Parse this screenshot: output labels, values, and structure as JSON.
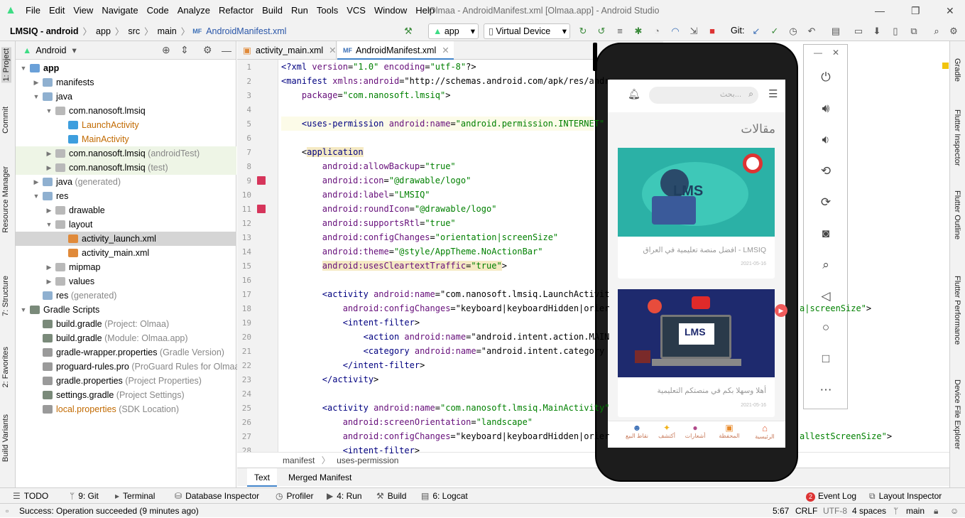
{
  "window": {
    "title": "Olmaa - AndroidManifest.xml [Olmaa.app] - Android Studio"
  },
  "menu": [
    "File",
    "Edit",
    "View",
    "Navigate",
    "Code",
    "Analyze",
    "Refactor",
    "Build",
    "Run",
    "Tools",
    "VCS",
    "Window",
    "Help"
  ],
  "breadcrumb": [
    "LMSIQ - android",
    "app",
    "src",
    "main",
    "AndroidManifest.xml"
  ],
  "toolbar": {
    "run_config": "app",
    "device": "Virtual Device",
    "git_label": "Git:"
  },
  "project_panel": {
    "view": "Android"
  },
  "tree": [
    {
      "t": "app",
      "d": 0,
      "arrow": "▼",
      "bold": true,
      "ic": "#6aa0d8"
    },
    {
      "t": "manifests",
      "d": 1,
      "arrow": "▶",
      "ic": "#8fb0d0"
    },
    {
      "t": "java",
      "d": 1,
      "arrow": "▼",
      "ic": "#8fb0d0"
    },
    {
      "t": "com.nanosoft.lmsiq",
      "d": 2,
      "arrow": "▼",
      "ic": "#b9b9b9"
    },
    {
      "t": "LaunchActivity",
      "d": 3,
      "arrow": "",
      "ic": "#3d9ede",
      "cls": "orange"
    },
    {
      "t": "MainActivity",
      "d": 3,
      "arrow": "",
      "ic": "#3d9ede",
      "cls": "orange"
    },
    {
      "t": "com.nanosoft.lmsiq",
      "d": 2,
      "arrow": "▶",
      "ic": "#b9b9b9",
      "suffix": " (androidTest)",
      "bg": "#eef5e6"
    },
    {
      "t": "com.nanosoft.lmsiq",
      "d": 2,
      "arrow": "▶",
      "ic": "#b9b9b9",
      "suffix": " (test)",
      "bg": "#eef5e6"
    },
    {
      "t": "java",
      "d": 1,
      "arrow": "▶",
      "ic": "#8fb0d0",
      "suffix": " (generated)"
    },
    {
      "t": "res",
      "d": 1,
      "arrow": "▼",
      "ic": "#8fb0d0"
    },
    {
      "t": "drawable",
      "d": 2,
      "arrow": "▶",
      "ic": "#b9b9b9"
    },
    {
      "t": "layout",
      "d": 2,
      "arrow": "▼",
      "ic": "#b9b9b9"
    },
    {
      "t": "activity_launch.xml",
      "d": 3,
      "arrow": "",
      "ic": "#e08a3a",
      "bg": "#d5d5d5"
    },
    {
      "t": "activity_main.xml",
      "d": 3,
      "arrow": "",
      "ic": "#e08a3a"
    },
    {
      "t": "mipmap",
      "d": 2,
      "arrow": "▶",
      "ic": "#b9b9b9"
    },
    {
      "t": "values",
      "d": 2,
      "arrow": "▶",
      "ic": "#b9b9b9"
    },
    {
      "t": "res",
      "d": 1,
      "arrow": "",
      "ic": "#8fb0d0",
      "suffix": " (generated)"
    },
    {
      "t": "Gradle Scripts",
      "d": 0,
      "arrow": "▼",
      "ic": "#7a8a7a"
    },
    {
      "t": "build.gradle",
      "d": 1,
      "arrow": "",
      "ic": "#7a8a7a",
      "suffix": " (Project: Olmaa)"
    },
    {
      "t": "build.gradle",
      "d": 1,
      "arrow": "",
      "ic": "#7a8a7a",
      "suffix": " (Module: Olmaa.app)"
    },
    {
      "t": "gradle-wrapper.properties",
      "d": 1,
      "arrow": "",
      "ic": "#9a9a9a",
      "suffix": " (Gradle Version)"
    },
    {
      "t": "proguard-rules.pro",
      "d": 1,
      "arrow": "",
      "ic": "#9a9a9a",
      "suffix": " (ProGuard Rules for Olmaa.a"
    },
    {
      "t": "gradle.properties",
      "d": 1,
      "arrow": "",
      "ic": "#9a9a9a",
      "suffix": " (Project Properties)"
    },
    {
      "t": "settings.gradle",
      "d": 1,
      "arrow": "",
      "ic": "#7a8a7a",
      "suffix": " (Project Settings)",
      "cls": "gray"
    },
    {
      "t": "local.properties",
      "d": 1,
      "arrow": "",
      "ic": "#9a9a9a",
      "suffix": " (SDK Location)",
      "cls": "orange"
    }
  ],
  "editor_tabs": [
    {
      "label": "activity_main.xml",
      "active": false
    },
    {
      "label": "AndroidManifest.xml",
      "active": true
    }
  ],
  "code": [
    [
      "<?xml version=\"1.0\" encoding=\"utf-8\"?>"
    ],
    [
      "<manifest xmlns:android=\"http://schemas.android.com/apk/res/andr"
    ],
    [
      "    package=\"com.nanosoft.lmsiq\">"
    ],
    [
      ""
    ],
    [
      "    <uses-permission android:name=\"android.permission.INTERNET\""
    ],
    [
      ""
    ],
    [
      "    <application"
    ],
    [
      "        android:allowBackup=\"true\""
    ],
    [
      "        android:icon=\"@drawable/logo\""
    ],
    [
      "        android:label=\"LMSIQ\""
    ],
    [
      "        android:roundIcon=\"@drawable/logo\""
    ],
    [
      "        android:supportsRtl=\"true\""
    ],
    [
      "        android:configChanges=\"orientation|screenSize\""
    ],
    [
      "        android:theme=\"@style/AppTheme.NoActionBar\""
    ],
    [
      "        android:usesCleartextTraffic=\"true\">"
    ],
    [
      ""
    ],
    [
      "        <activity android:name=\"com.nanosoft.lmsiq.LaunchActivit"
    ],
    [
      "            android:configChanges=\"keyboard|keyboardHidden|orier"
    ],
    [
      "            <intent-filter>"
    ],
    [
      "                <action android:name=\"android.intent.action.MAIN"
    ],
    [
      "                <category android:name=\"android.intent.category"
    ],
    [
      "            </intent-filter>"
    ],
    [
      "        </activity>"
    ],
    [
      ""
    ],
    [
      "        <activity android:name=\"com.nanosoft.lmsiq.MainActivity\""
    ],
    [
      "            android:screenOrientation=\"landscape\""
    ],
    [
      "            android:configChanges=\"keyboard|keyboardHidden|orier"
    ],
    [
      "            <intent-filter>"
    ]
  ],
  "code_right": {
    "line18": "a|screenSize\">",
    "line27": "allestScreenSize\">"
  },
  "xml_breadcrumb": [
    "manifest",
    "uses-permission"
  ],
  "editor_bottom_tabs": [
    "Text",
    "Merged Manifest"
  ],
  "left_tool_tabs": [
    "1: Project",
    "Commit",
    "Resource Manager",
    "7: Structure",
    "2: Favorites",
    "Build Variants"
  ],
  "right_tool_tabs": [
    "Gradle",
    "Flutter Inspector",
    "Flutter Outline",
    "Flutter Performance",
    "Device File Explorer"
  ],
  "bottom_tools": [
    {
      "label": "TODO"
    },
    {
      "label": "9: Git"
    },
    {
      "label": "Terminal"
    },
    {
      "label": "Database Inspector"
    },
    {
      "label": "Profiler"
    },
    {
      "label": "4: Run"
    },
    {
      "label": "Build"
    },
    {
      "label": "6: Logcat"
    }
  ],
  "bottom_tools_right": [
    {
      "label": "Event Log",
      "badge": "2"
    },
    {
      "label": "Layout Inspector"
    }
  ],
  "status": {
    "message": "Success: Operation succeeded (9 minutes ago)",
    "position": "5:67",
    "line_sep": "CRLF",
    "encoding": "UTF-8",
    "indent": "4 spaces",
    "branch": "main"
  },
  "phone_app": {
    "search_placeholder": "بحث...",
    "section_title": "مقالات",
    "cards": [
      {
        "banner": "LMS",
        "title": "LMSIQ - افضل منصة تعليمية في العراق",
        "date": "2021-05-16"
      },
      {
        "banner": "LMS",
        "title": "أهلا وسهلا بكم في منصتكم التعليمية",
        "date": "2021-05-16"
      }
    ],
    "bottom_nav": [
      "الرئيسية",
      "المحفظة",
      "أشعارات",
      "أكتشف",
      "نقاط البيع"
    ]
  },
  "emulator_controls": [
    "power-icon",
    "volume-up-icon",
    "volume-down-icon",
    "rotate-left-icon",
    "rotate-right-icon",
    "camera-icon",
    "zoom-icon",
    "back-icon",
    "home-icon",
    "overview-icon",
    "more-icon"
  ]
}
